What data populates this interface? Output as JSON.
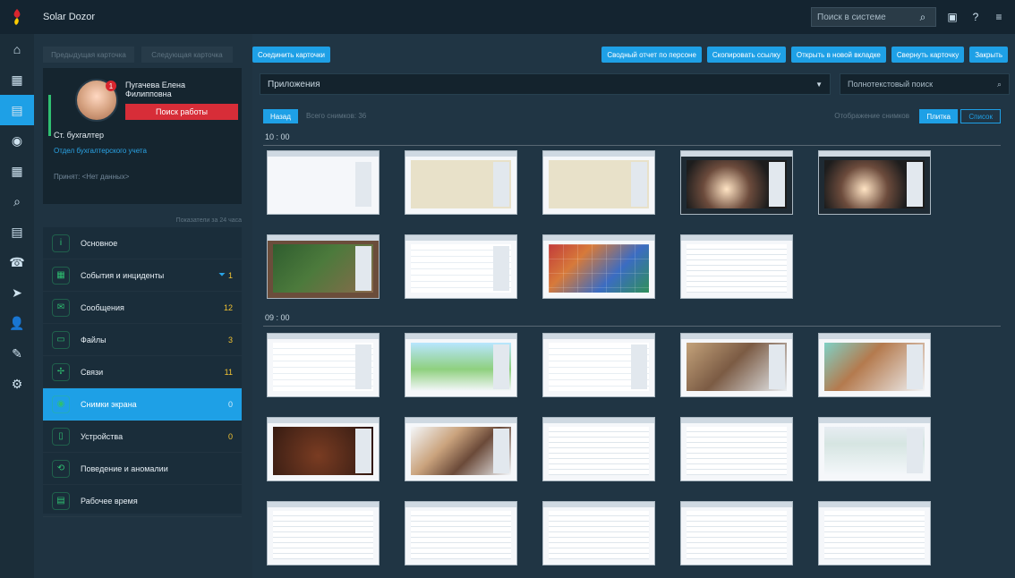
{
  "app": {
    "title": "Solar Dozor"
  },
  "topbar": {
    "search_placeholder": "Поиск в системе",
    "icons": [
      "search-icon",
      "monitor-icon",
      "help-icon",
      "user-menu-icon"
    ]
  },
  "left_nav": {
    "items": [
      {
        "name": "home"
      },
      {
        "name": "organization"
      },
      {
        "name": "persons",
        "active": true
      },
      {
        "name": "profiles"
      },
      {
        "name": "calendar"
      },
      {
        "name": "search"
      },
      {
        "name": "news"
      },
      {
        "name": "alerts"
      },
      {
        "name": "navigation"
      },
      {
        "name": "users"
      },
      {
        "name": "tools"
      },
      {
        "name": "settings"
      }
    ]
  },
  "person_panel": {
    "disabled_buttons": [
      "Предыдущая карточка",
      "Следующая карточка"
    ],
    "name": "Пугачева Елена Филипповна",
    "badge_count": "1",
    "job_search_label": "Поиск работы",
    "role": "Ст. бухгалтер",
    "department": "Отдел бухгалтерского учета",
    "hired": "Принят: <Нет данных>",
    "period_label": "Показатели за 24 часа",
    "sections": [
      {
        "label": "Основное",
        "count": "",
        "icon": "info-icon"
      },
      {
        "label": "События и инциденты",
        "count": "1",
        "icon": "events-icon",
        "filter": true
      },
      {
        "label": "Сообщения",
        "count": "12",
        "icon": "messages-icon"
      },
      {
        "label": "Файлы",
        "count": "3",
        "icon": "files-icon"
      },
      {
        "label": "Связи",
        "count": "11",
        "icon": "links-icon"
      },
      {
        "label": "Снимки экрана",
        "count": "0",
        "icon": "camera-icon",
        "active": true
      },
      {
        "label": "Устройства",
        "count": "0",
        "icon": "device-icon"
      },
      {
        "label": "Поведение и аномалии",
        "count": "",
        "icon": "behavior-icon"
      },
      {
        "label": "Рабочее время",
        "count": "",
        "icon": "worktime-icon"
      }
    ]
  },
  "main": {
    "top_left_button": "Соединить карточки",
    "top_buttons": [
      "Сводный отчет по персоне",
      "Скопировать ссылку",
      "Открыть в новой вкладке",
      "Свернуть карточку",
      "Закрыть"
    ],
    "filters": {
      "apps_label": "Приложения",
      "fulltext_placeholder": "Полнотекстовый поиск"
    },
    "toolbar2": {
      "back": "Назад",
      "total": "Всего снимков: 36",
      "display_label": "Отображение снимков",
      "mode_tile": "Плитка",
      "mode_list": "Список"
    },
    "groups": [
      {
        "time": "10 : 00"
      },
      {
        "time": "09 : 00"
      }
    ]
  }
}
